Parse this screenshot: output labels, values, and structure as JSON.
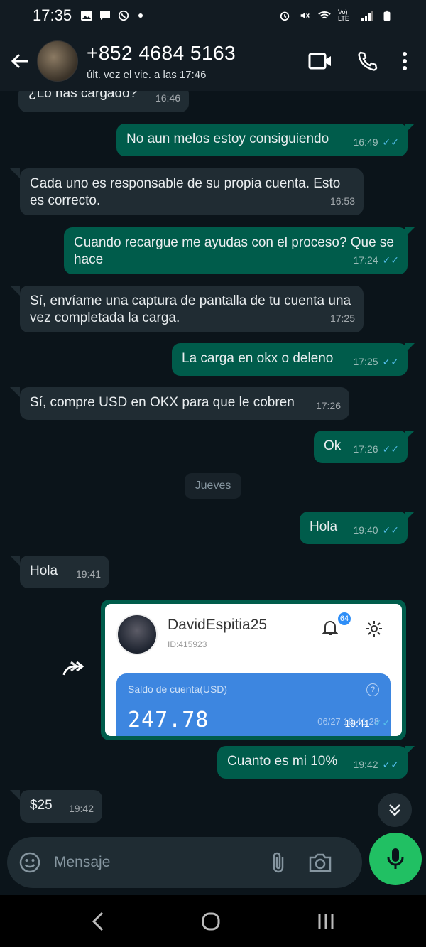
{
  "status_bar": {
    "time": "17:35",
    "network_label": "Vo) LTE"
  },
  "header": {
    "contact_name": "+852 4684 5163",
    "last_seen": "últ. vez el vie. a las 17:46"
  },
  "messages": [
    {
      "dir": "in",
      "text": "¿Lo has cargado?",
      "time": "16:46"
    },
    {
      "dir": "out",
      "text": "No aun melos estoy consiguiendo",
      "time": "16:49"
    },
    {
      "dir": "in",
      "text": "Cada uno es responsable de su propia cuenta. Esto es correcto.",
      "time": "16:53"
    },
    {
      "dir": "out",
      "text": "Cuando recargue  me ayudas con el proceso? Que se hace",
      "time": "17:24"
    },
    {
      "dir": "in",
      "text": "Sí, envíame una captura de pantalla de tu cuenta una vez completada la carga.",
      "time": "17:25"
    },
    {
      "dir": "out",
      "text": "La carga en okx o deleno",
      "time": "17:25"
    },
    {
      "dir": "in",
      "text": "Sí, compre USD en OKX para que le cobren",
      "time": "17:26"
    },
    {
      "dir": "out",
      "text": "Ok",
      "time": "17:26"
    },
    {
      "dir": "out",
      "text": "Hola",
      "time": "19:40"
    },
    {
      "dir": "in",
      "text": "Hola",
      "time": "19:41"
    },
    {
      "dir": "out",
      "text": "Cuanto es mi 10%",
      "time": "19:42"
    },
    {
      "dir": "in",
      "text": "$25",
      "time": "19:42"
    }
  ],
  "day_separator": "Jueves",
  "image_message": {
    "time": "19:41",
    "username": "DavidEspitia25",
    "user_id": "ID:415923",
    "notification_count": "64",
    "balance_label": "Saldo de cuenta(USD)",
    "balance_value": "247.78",
    "balance_timestamp": "06/27 19:41:28"
  },
  "composer": {
    "placeholder": "Mensaje"
  },
  "colors": {
    "chat_bg": "#0b141a",
    "incoming_bubble": "#202c33",
    "outgoing_bubble": "#005c4b",
    "read_ticks": "#53bdeb",
    "mic_button": "#21c063"
  }
}
